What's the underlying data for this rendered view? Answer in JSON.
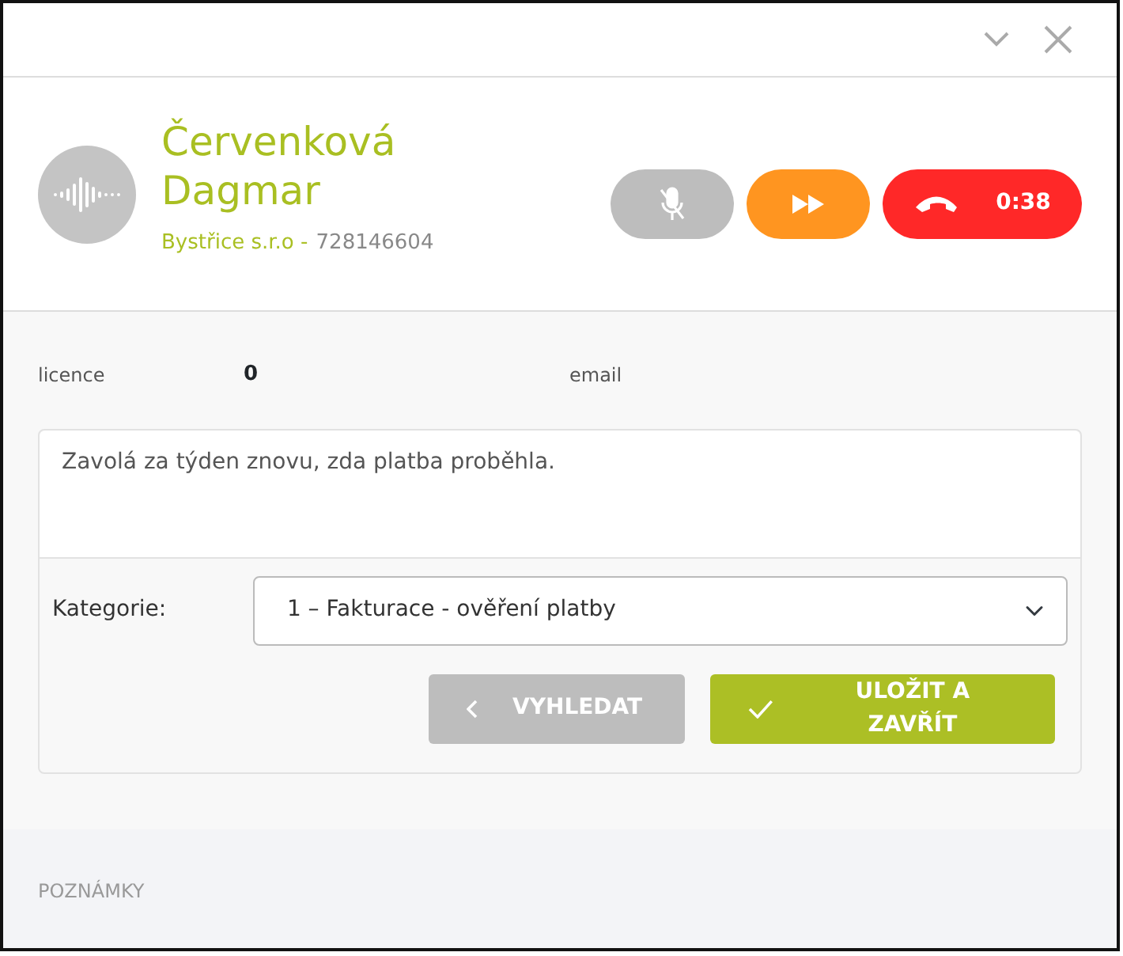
{
  "contact": {
    "name_line_1": "Červenková",
    "name_line_2": "Dagmar",
    "company": "Bystřice s.r.o -",
    "phone": "728146604"
  },
  "call": {
    "timer": "0:38"
  },
  "fields": [
    {
      "label": "licence",
      "value": "0"
    },
    {
      "label": "email"
    }
  ],
  "note": {
    "value": "Zavolá za týden znovu, zda platba proběhla."
  },
  "category": {
    "label": "Kategorie:",
    "value": "1 – Fakturace - ověření platby"
  },
  "buttons": [
    {
      "label": "VYHLEDAT",
      "kind": "back"
    },
    {
      "label": "ULOŽIT A ZAVŘÍT",
      "kind": "save"
    }
  ],
  "notes_section": {
    "title": "POZNÁMKY"
  }
}
